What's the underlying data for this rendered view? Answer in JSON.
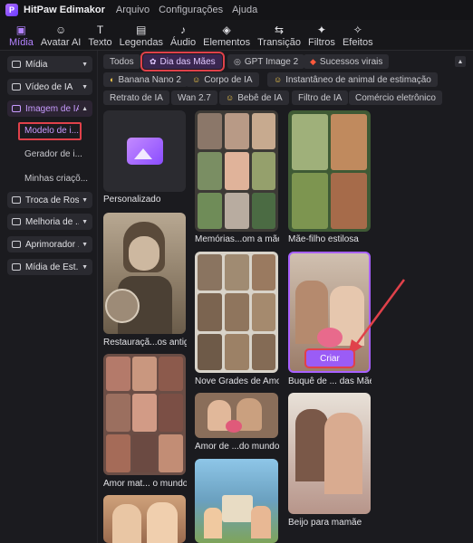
{
  "app": {
    "logo_text": "P",
    "name": "HitPaw Edimakor"
  },
  "menu": [
    "Arquivo",
    "Configurações",
    "Ajuda"
  ],
  "toolbar": [
    {
      "label": "Mídia",
      "icon": "media-icon",
      "glyph": "▣",
      "active": true
    },
    {
      "label": "Avatar AI",
      "icon": "avatar-icon",
      "glyph": "☺",
      "active": false
    },
    {
      "label": "Texto",
      "icon": "text-icon",
      "glyph": "T",
      "active": false
    },
    {
      "label": "Legendas",
      "icon": "subtitles-icon",
      "glyph": "▤",
      "active": false
    },
    {
      "label": "Áudio",
      "icon": "audio-icon",
      "glyph": "♪",
      "active": false
    },
    {
      "label": "Elementos",
      "icon": "elements-icon",
      "glyph": "◈",
      "active": false
    },
    {
      "label": "Transição",
      "icon": "transition-icon",
      "glyph": "⇆",
      "active": false
    },
    {
      "label": "Filtros",
      "icon": "filters-icon",
      "glyph": "✦",
      "active": false
    },
    {
      "label": "Efeitos",
      "icon": "effects-icon",
      "glyph": "✧",
      "active": false
    }
  ],
  "sidebar": {
    "buttons": [
      {
        "label": "Mídia",
        "expanded": false
      },
      {
        "label": "Vídeo de IA",
        "expanded": false
      },
      {
        "label": "Imagem de IA",
        "expanded": true,
        "active": true
      },
      {
        "label": "Troca de Rost...",
        "expanded": false
      },
      {
        "label": "Melhoria de ...",
        "expanded": false
      },
      {
        "label": "Aprimorador ...",
        "expanded": false
      },
      {
        "label": "Mídia de Est...",
        "expanded": false
      }
    ],
    "subitems": [
      {
        "label": "Modelo de i...",
        "selected": true
      },
      {
        "label": "Gerador de i...",
        "selected": false
      },
      {
        "label": "Minhas criaçõ...",
        "selected": false
      }
    ]
  },
  "chips": [
    {
      "label": "Todos",
      "icon": ""
    },
    {
      "label": "Dia das Mães",
      "icon": "sparkle-icon",
      "glyph": "✿",
      "active": true
    },
    {
      "label": "GPT Image 2",
      "icon": "gpt-icon",
      "glyph": "◎"
    },
    {
      "label": "Sucessos virais",
      "icon": "fire-icon",
      "glyph": "🔥"
    },
    {
      "label": "Banana Nano 2",
      "icon": "banana-icon",
      "glyph": "◐"
    },
    {
      "label": "Corpo de IA",
      "icon": "face-icon",
      "glyph": "☺"
    },
    {
      "label": "Instantâneo de animal de estimação",
      "icon": "pet-icon",
      "glyph": "☺"
    },
    {
      "label": "Retrato de IA",
      "icon": ""
    },
    {
      "label": "Wan 2.7",
      "icon": ""
    },
    {
      "label": "Bebê de IA",
      "icon": "baby-icon",
      "glyph": "☺"
    },
    {
      "label": "Filtro de IA",
      "icon": ""
    },
    {
      "label": "Comércio eletrônico",
      "icon": ""
    }
  ],
  "templates": {
    "custom": "Personalizado",
    "restore": "Restauraçã...os antigas",
    "memories": "Memórias...om a mãe",
    "mom_son": "Mãe-filho estilosa",
    "grids": "Nove Grades de Amor",
    "bouquet": "Buquê de ... das Mães",
    "collage": "Amor mat... o mundo",
    "hug": "Amor de ...do mundo",
    "beijo": "Beijo para mamãe"
  },
  "create_button": "Criar",
  "colors": {
    "accent": "#a861ff",
    "highlight_red": "#e0414a",
    "background": "#1b1b1f"
  }
}
